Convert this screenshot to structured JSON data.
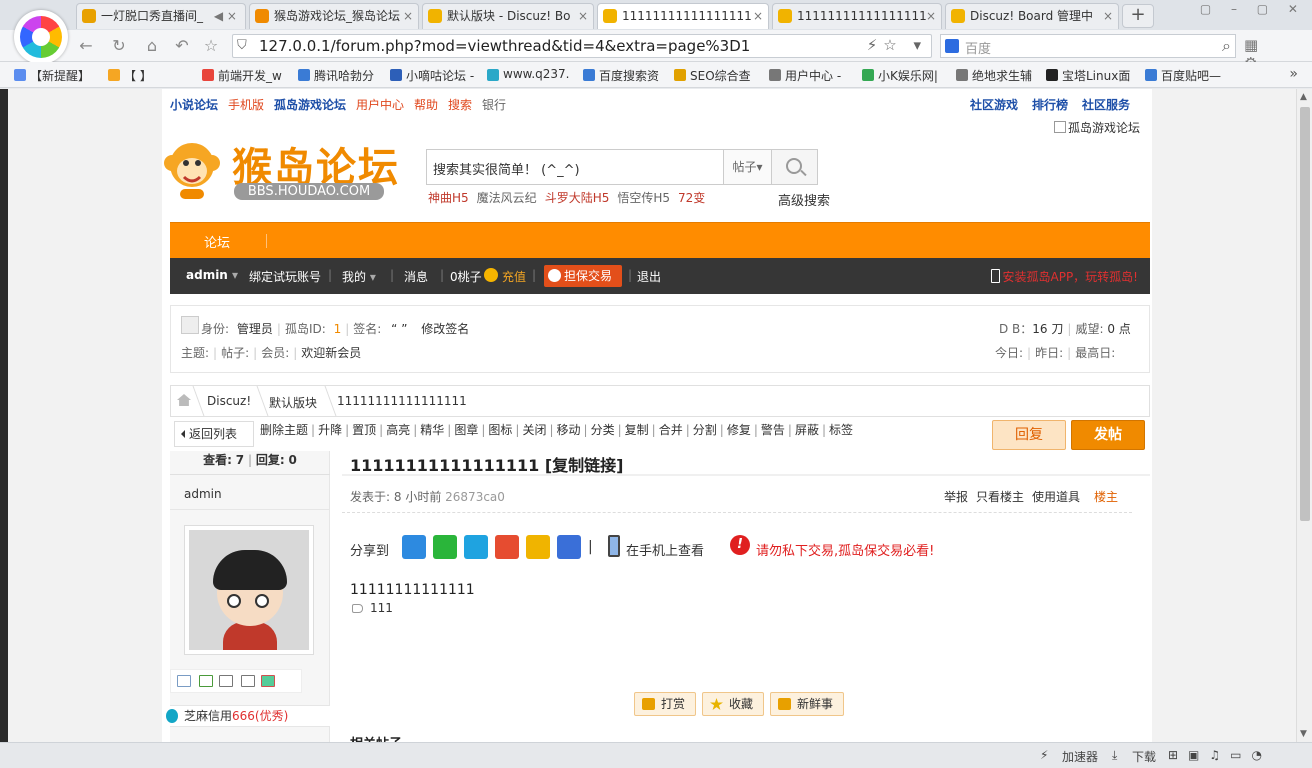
{
  "browser": {
    "tabs": [
      {
        "title": "一灯脱口秀直播间_",
        "active": false
      },
      {
        "title": "猴岛游戏论坛_猴岛论坛",
        "active": false
      },
      {
        "title": "默认版块 - Discuz! Bo",
        "active": false
      },
      {
        "title": "11111111111111111",
        "active": true
      },
      {
        "title": "11111111111111111",
        "active": false
      },
      {
        "title": "Discuz! Board 管理中",
        "active": false
      }
    ],
    "url": "127.0.0.1/forum.php?mod=viewthread&tid=4&extra=page%3D1",
    "search_placeholder": "百度",
    "bookmarks": [
      "【新提醒】",
      "【         】",
      "前端开发_w",
      "腾讯哈勃分",
      "小嘀咕论坛 -",
      "www.q237.",
      "百度搜索资",
      "SEO综合查",
      "用户中心 -",
      "小K娱乐网|",
      "绝地求生辅",
      "宝塔Linux面",
      "百度贴吧—"
    ],
    "bookmark_colors": [
      "#5b8def",
      "#f5a623",
      "#e8453c",
      "#3a7bd5",
      "#2d5fb8",
      "#2aa8c8",
      "#3a7bd5",
      "#e1a100",
      "#777777",
      "#34a853",
      "#777777",
      "#222222",
      "#3a7bd5"
    ],
    "status": {
      "accelerator": "加速器",
      "download": "下载"
    }
  },
  "forum": {
    "toplinks_left": [
      {
        "text": "小说论坛",
        "style": "blue"
      },
      {
        "text": "手机版",
        "style": "red"
      },
      {
        "text": "孤岛游戏论坛",
        "style": "blue"
      },
      {
        "text": "用户中心",
        "style": "red"
      },
      {
        "text": "帮助",
        "style": "red"
      },
      {
        "text": "搜索",
        "style": "red"
      },
      {
        "text": "银行",
        "style": "gray"
      }
    ],
    "toplinks_right": [
      "社区游戏",
      "排行榜",
      "社区服务"
    ],
    "broken_image_alt": "孤岛游戏论坛",
    "logo": {
      "title": "猴岛论坛",
      "subtitle": "BBS.HOUDAO.COM"
    },
    "search": {
      "placeholder": "搜索其实很简单！ (^_^)",
      "type": "帖子",
      "advanced": "高级搜索"
    },
    "hotwords": [
      {
        "text": "神曲H5",
        "color": "#c0392b"
      },
      {
        "text": "魔法风云纪",
        "color": "#666666"
      },
      {
        "text": "斗罗大陆H5",
        "color": "#c0392b"
      },
      {
        "text": "悟空传H5",
        "color": "#666666"
      },
      {
        "text": "72变",
        "color": "#c0392b"
      }
    ],
    "nav": {
      "item": "论坛"
    },
    "usernav": {
      "user": "admin",
      "bind": "绑定试玩账号",
      "mine": "我的",
      "messages": "消息",
      "peach": "0桃子",
      "recharge": "充值",
      "guarantee": "担保交易",
      "logout": "退出",
      "app": "安装孤岛APP，玩转孤岛!"
    },
    "userinfo": {
      "identity_label": "身份:",
      "identity": "管理员",
      "id_label": "孤岛ID:",
      "id": "1",
      "sign_label": "签名:",
      "sign": "“ ”",
      "edit_sign": "修改签名",
      "db_label": "D B：",
      "db": "16 刀",
      "prestige_label": "威望:",
      "prestige": "0 点",
      "topics_label": "主题:",
      "posts_label": "帖子:",
      "members_label": "会员:",
      "welcome": "欢迎新会员",
      "today_label": "今日:",
      "yesterday_label": "昨日:",
      "max_label": "最高日:"
    },
    "breadcrumb": [
      "Discuz!",
      "默认版块",
      "11111111111111111"
    ],
    "back_to_list": "返回列表",
    "admin_actions": [
      "删除主题",
      "升降",
      "置顶",
      "高亮",
      "精华",
      "图章",
      "图标",
      "关闭",
      "移动",
      "分类",
      "复制",
      "合并",
      "分割",
      "修复",
      "警告",
      "屏蔽",
      "标签"
    ],
    "reply_button": "回复",
    "post_button": "发帖",
    "stats": {
      "views_label": "查看:",
      "views": "7",
      "replies_label": "回复:",
      "replies": "0"
    },
    "author": "admin",
    "credit": {
      "label": "芝麻信用",
      "value": "666(优秀)"
    },
    "post": {
      "title": "11111111111111111 [复制链接]",
      "posted_prefix": "发表于:",
      "posted_time": "8 小时前",
      "hash": "26873ca0",
      "actions": [
        "举报",
        "只看楼主",
        "使用道具"
      ],
      "floor": "楼主",
      "share_label": "分享到",
      "share_icons": [
        {
          "name": "qq",
          "color": "#2d8ae0"
        },
        {
          "name": "wechat",
          "color": "#2ab53a"
        },
        {
          "name": "pengyou",
          "color": "#1fa3e0"
        },
        {
          "name": "weibo",
          "color": "#e64c30"
        },
        {
          "name": "qzone",
          "color": "#f0b400"
        },
        {
          "name": "tieba",
          "color": "#3a6fd8"
        }
      ],
      "share_sep": "|",
      "mobile_view": "在手机上查看",
      "warning": "请勿私下交易,孤岛保交易必看!",
      "content": "11111111111111",
      "tag": "111",
      "buttons": [
        "打赏",
        "收藏",
        "新鲜事"
      ],
      "related": "相关帖子"
    }
  }
}
